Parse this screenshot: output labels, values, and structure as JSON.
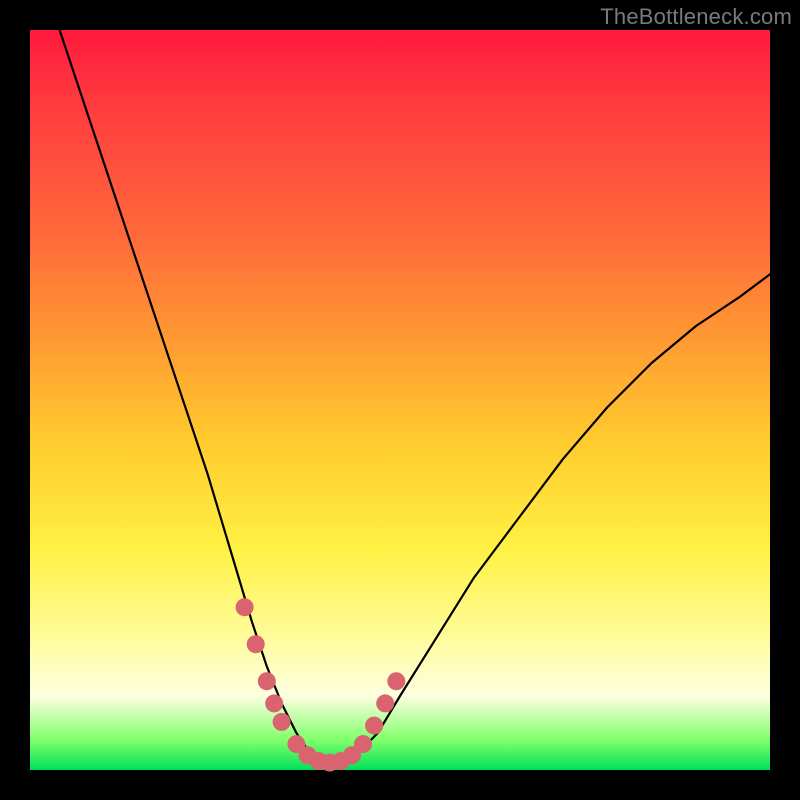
{
  "watermark": {
    "text": "TheBottleneck.com"
  },
  "chart_data": {
    "type": "line",
    "title": "",
    "xlabel": "",
    "ylabel": "",
    "xlim": [
      0,
      100
    ],
    "ylim": [
      0,
      100
    ],
    "series": [
      {
        "name": "bottleneck-curve",
        "x": [
          4,
          8,
          12,
          16,
          20,
          24,
          27,
          30,
          32,
          34,
          36,
          38,
          40,
          42,
          44,
          47,
          50,
          55,
          60,
          66,
          72,
          78,
          84,
          90,
          96,
          100
        ],
        "y": [
          100,
          88,
          76,
          64,
          52,
          40,
          30,
          20,
          14,
          9,
          5,
          2,
          1,
          1,
          2,
          5,
          10,
          18,
          26,
          34,
          42,
          49,
          55,
          60,
          64,
          67
        ]
      }
    ],
    "markers": {
      "name": "highlight-dots",
      "color": "#d9636e",
      "x": [
        29,
        30.5,
        32,
        33,
        34,
        36,
        37.5,
        39,
        40.5,
        42,
        43.5,
        45,
        46.5,
        48,
        49.5
      ],
      "y": [
        22,
        17,
        12,
        9,
        6.5,
        3.5,
        2,
        1.2,
        1,
        1.2,
        2,
        3.5,
        6,
        9,
        12
      ]
    }
  }
}
